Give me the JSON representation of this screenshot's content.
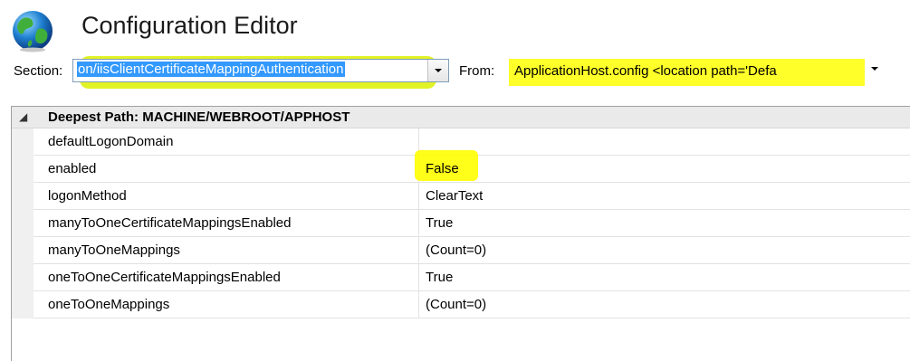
{
  "header": {
    "title": "Configuration Editor",
    "icon": "globe-icon"
  },
  "toolbar": {
    "section_label": "Section:",
    "section_value": "on/iisClientCertificateMappingAuthentication",
    "from_label": "From:",
    "from_value": "ApplicationHost.config <location path='Defa"
  },
  "grid": {
    "group_label": "Deepest Path: MACHINE/WEBROOT/APPHOST",
    "rows": [
      {
        "name": "defaultLogonDomain",
        "value": ""
      },
      {
        "name": "enabled",
        "value": "False"
      },
      {
        "name": "logonMethod",
        "value": "ClearText"
      },
      {
        "name": "manyToOneCertificateMappingsEnabled",
        "value": "True"
      },
      {
        "name": "manyToOneMappings",
        "value": "(Count=0)"
      },
      {
        "name": "oneToOneCertificateMappingsEnabled",
        "value": "True"
      },
      {
        "name": "oneToOneMappings",
        "value": "(Count=0)"
      }
    ]
  },
  "colors": {
    "highlight": "#ffff2a",
    "selection": "#3399ff"
  }
}
